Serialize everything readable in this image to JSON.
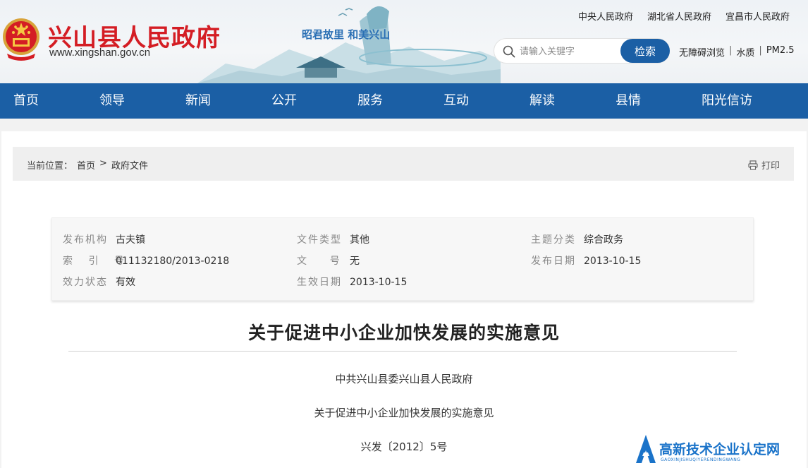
{
  "header": {
    "site_title": "兴山县人民政府",
    "site_url": "www.xingshan.gov.cn",
    "slogan": "昭君故里  和美兴山",
    "top_links": [
      "中央人民政府",
      "湖北省人民政府",
      "宜昌市人民政府"
    ],
    "search": {
      "placeholder": "请输入关键字",
      "button_label": "检索"
    },
    "tools": [
      "无障碍浏览",
      "水质",
      "PM2.5"
    ],
    "tool_separator": "|"
  },
  "nav": {
    "items": [
      "首页",
      "领导",
      "新闻",
      "公开",
      "服务",
      "互动",
      "解读",
      "县情",
      "阳光信访"
    ]
  },
  "breadcrumb": {
    "label": "当前位置：",
    "home": "首页",
    "separator": ">",
    "current": "政府文件",
    "print_label": "打印"
  },
  "metadata": {
    "issuer_key": "发布机构",
    "issuer": "古夫镇",
    "doc_type_key": "文件类型",
    "doc_type": "其他",
    "topic_key": "主题分类",
    "topic": "综合政务",
    "index_key": "索 引 号",
    "index_no": "011132180/2013-0218",
    "doc_no_key": "文    号",
    "doc_no": "无",
    "publish_date_key": "发布日期",
    "publish_date": "2013-10-15",
    "status_key": "效力状态",
    "status": "有效",
    "effective_date_key": "生效日期",
    "effective_date": "2013-10-15"
  },
  "document": {
    "title": "关于促进中小企业加快发展的实施意见",
    "paragraphs": [
      "中共兴山县委兴山县人民政府",
      "关于促进中小企业加快发展的实施意见",
      "兴发〔2012〕5号"
    ]
  },
  "watermark": {
    "text": "高新技术企业认定网",
    "sub": "GAOXINJISHUQIYERENDINGWANG"
  },
  "colors": {
    "brand_red": "#d41d24",
    "nav_blue": "#1b5fa5",
    "watermark_blue": "#1a73c9"
  }
}
